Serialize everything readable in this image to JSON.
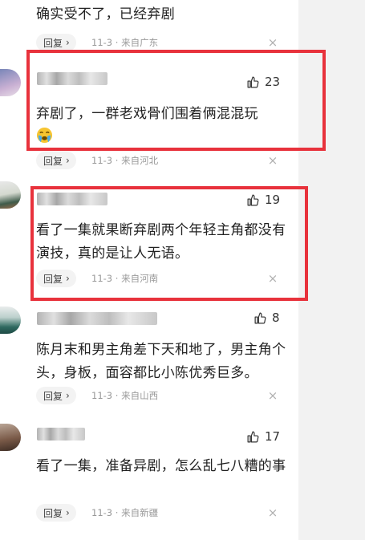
{
  "comments": [
    {
      "text": "确实受不了，已经弃剧",
      "likes": "",
      "reply_label": "回复",
      "meta": "11-3 · 来自广东"
    },
    {
      "text": "弃剧了，一群老戏骨们围着俩混混玩",
      "likes": "23",
      "reply_label": "回复",
      "meta": "11-3 · 来自河北"
    },
    {
      "text": "看了一集就果断弃剧两个年轻主角都没有演技，真的是让人无语。",
      "likes": "19",
      "reply_label": "回复",
      "meta": "11-3 · 来自河南"
    },
    {
      "text": "陈月末和男主角差下天和地了，男主角个头，身板，面容都比小陈优秀巨多。",
      "likes": "8",
      "reply_label": "回复",
      "meta": "11-3 · 来自山西"
    },
    {
      "text": "看了一集，准备异剧，怎么乱七八糟的事",
      "likes": "17",
      "reply_label": "回复",
      "meta": "11-3 · 来自新疆"
    }
  ],
  "icons": {
    "like": "thumbs-up-icon",
    "reply": "chevron-right-icon",
    "close": "close-icon",
    "emoji": "crying-face-emoji"
  },
  "colors": {
    "highlight": "#e8323c",
    "side_panel": "#f2f2f2"
  }
}
